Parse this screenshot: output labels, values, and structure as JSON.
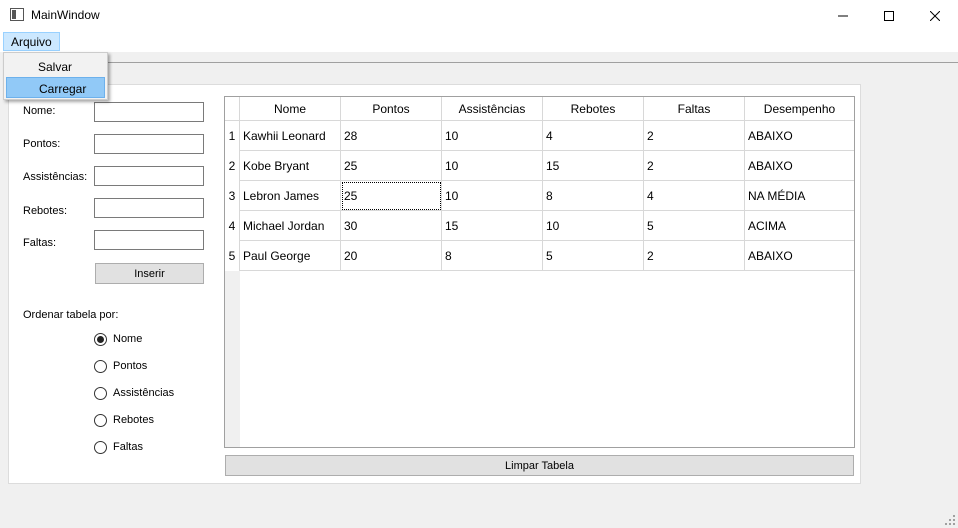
{
  "window": {
    "title": "MainWindow",
    "icon": "app-window-icon"
  },
  "menu": {
    "arquivo": "Arquivo",
    "items": [
      {
        "label": "Salvar"
      },
      {
        "label": "Carregar"
      }
    ]
  },
  "form": {
    "labels": [
      "Nome:",
      "Pontos:",
      "Assistências:",
      "Rebotes:",
      "Faltas:"
    ],
    "values": [
      "",
      "",
      "",
      "",
      ""
    ],
    "insert_button": "Inserir"
  },
  "sort": {
    "label": "Ordenar tabela por:",
    "options": [
      "Nome",
      "Pontos",
      "Assistências",
      "Rebotes",
      "Faltas"
    ],
    "selected": "Nome"
  },
  "table": {
    "headers": [
      "Nome",
      "Pontos",
      "Assistências",
      "Rebotes",
      "Faltas",
      "Desempenho"
    ],
    "row_numbers": [
      "1",
      "2",
      "3",
      "4",
      "5"
    ],
    "rows": [
      [
        "Kawhii Leonard",
        "28",
        "10",
        "4",
        "2",
        "ABAIXO"
      ],
      [
        "Kobe Bryant",
        "25",
        "10",
        "15",
        "2",
        "ABAIXO"
      ],
      [
        "Lebron James",
        "25",
        "10",
        "8",
        "4",
        "NA MÉDIA"
      ],
      [
        "Michael Jordan",
        "30",
        "15",
        "10",
        "5",
        "ACIMA"
      ],
      [
        "Paul George",
        "20",
        "8",
        "5",
        "2",
        "ABAIXO"
      ]
    ]
  },
  "clear_button": "Limpar Tabela"
}
